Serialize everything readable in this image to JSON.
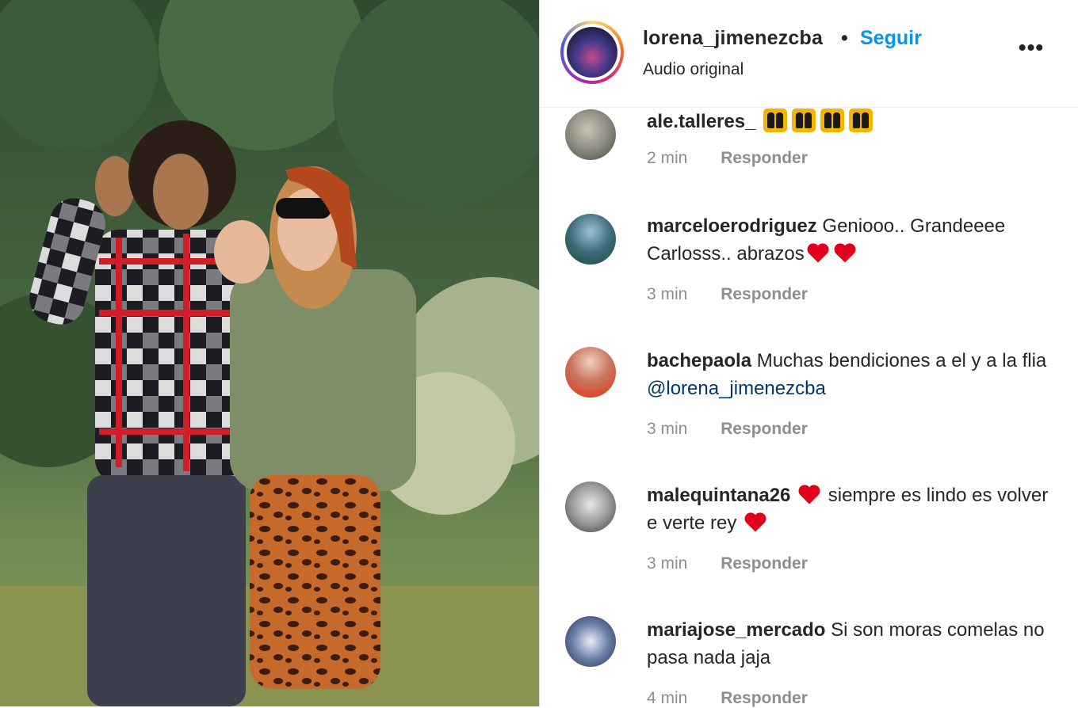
{
  "post": {
    "username": "lorena_jimenezcba",
    "separator": "•",
    "follow_label": "Seguir",
    "audio_label": "Audio original",
    "more_label": "•••"
  },
  "comments": [
    {
      "username": "ale.talleres_",
      "text": "",
      "emoji": [
        "praying-hands",
        "praying-hands",
        "praying-hands",
        "praying-hands"
      ],
      "time": "2 min",
      "reply_label": "Responder"
    },
    {
      "username": "marceloerodriguez",
      "text": "Geniooo.. Grandeeee Carlosss.. abrazos",
      "time": "3 min",
      "reply_label": "Responder"
    },
    {
      "username": "bachepaola",
      "text": "Muchas bendiciones a el y a la flia",
      "mention": "@lorena_jimenezcba",
      "time": "3 min",
      "reply_label": "Responder"
    },
    {
      "username": "malequintana26",
      "text_part1": "siempre es lindo es volver e verte rey",
      "time": "3 min",
      "reply_label": "Responder"
    },
    {
      "username": "mariajose_mercado",
      "text": "Si son moras comelas no pasa nada jaja",
      "time": "4 min",
      "reply_label": "Responder"
    }
  ],
  "colors": {
    "follow_blue": "#0095f6",
    "heart_red": "#e0001b",
    "muted_gray": "#8e8e8e",
    "mention_blue": "#00376b"
  }
}
